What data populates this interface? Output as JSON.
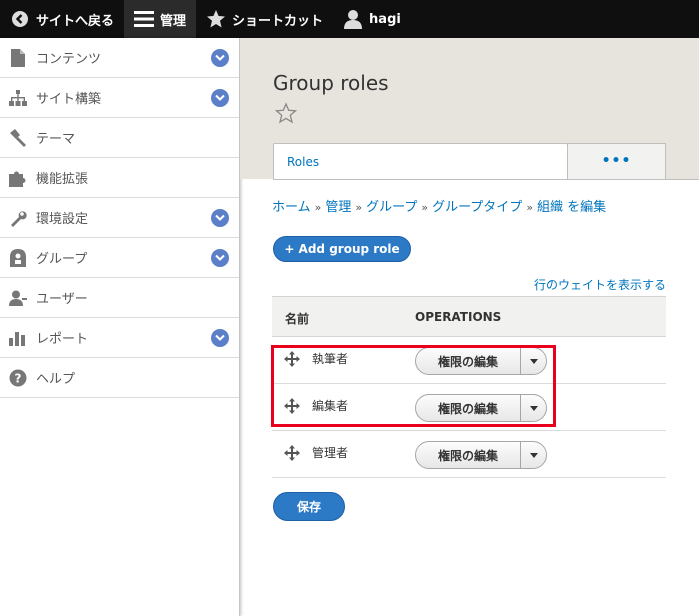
{
  "toolbar": {
    "back_label": "サイトへ戻る",
    "manage_label": "管理",
    "shortcuts_label": "ショートカット",
    "user_label": "hagi"
  },
  "sidebar": {
    "items": [
      {
        "label": "コンテンツ",
        "icon": "file-icon",
        "expandable": true
      },
      {
        "label": "サイト構築",
        "icon": "sitemap-icon",
        "expandable": true
      },
      {
        "label": "テーマ",
        "icon": "paintbrush-icon",
        "expandable": false
      },
      {
        "label": "機能拡張",
        "icon": "puzzle-icon",
        "expandable": false
      },
      {
        "label": "環境設定",
        "icon": "wrench-icon",
        "expandable": true
      },
      {
        "label": "グループ",
        "icon": "group-icon",
        "expandable": true
      },
      {
        "label": "ユーザー",
        "icon": "user-icon",
        "expandable": false
      },
      {
        "label": "レポート",
        "icon": "bar-chart-icon",
        "expandable": true
      },
      {
        "label": "ヘルプ",
        "icon": "help-icon",
        "expandable": false
      }
    ]
  },
  "page": {
    "title": "Group roles",
    "tabs": [
      {
        "label": "Roles",
        "active": true
      },
      {
        "label": "•••",
        "active": false
      }
    ],
    "breadcrumb": [
      "ホーム",
      "管理",
      "グループ",
      "グループタイプ",
      "組織 を編集"
    ],
    "breadcrumb_sep": "»",
    "add_button": "+ Add group role",
    "show_weights": "行のウェイトを表示する",
    "table": {
      "headers": {
        "name": "名前",
        "operations": "OPERATIONS"
      },
      "rows": [
        {
          "name": "執筆者",
          "operation": "権限の編集"
        },
        {
          "name": "編集者",
          "operation": "権限の編集"
        },
        {
          "name": "管理者",
          "operation": "権限の編集"
        }
      ]
    },
    "save_button": "保存"
  },
  "colors": {
    "toolbar_bg": "#0f0f0f",
    "link": "#0074bd",
    "primary_button": "#2c79c6",
    "chevron": "#5b7fc9",
    "highlight": "#e8001c",
    "header_bg": "#e6e4dd"
  }
}
